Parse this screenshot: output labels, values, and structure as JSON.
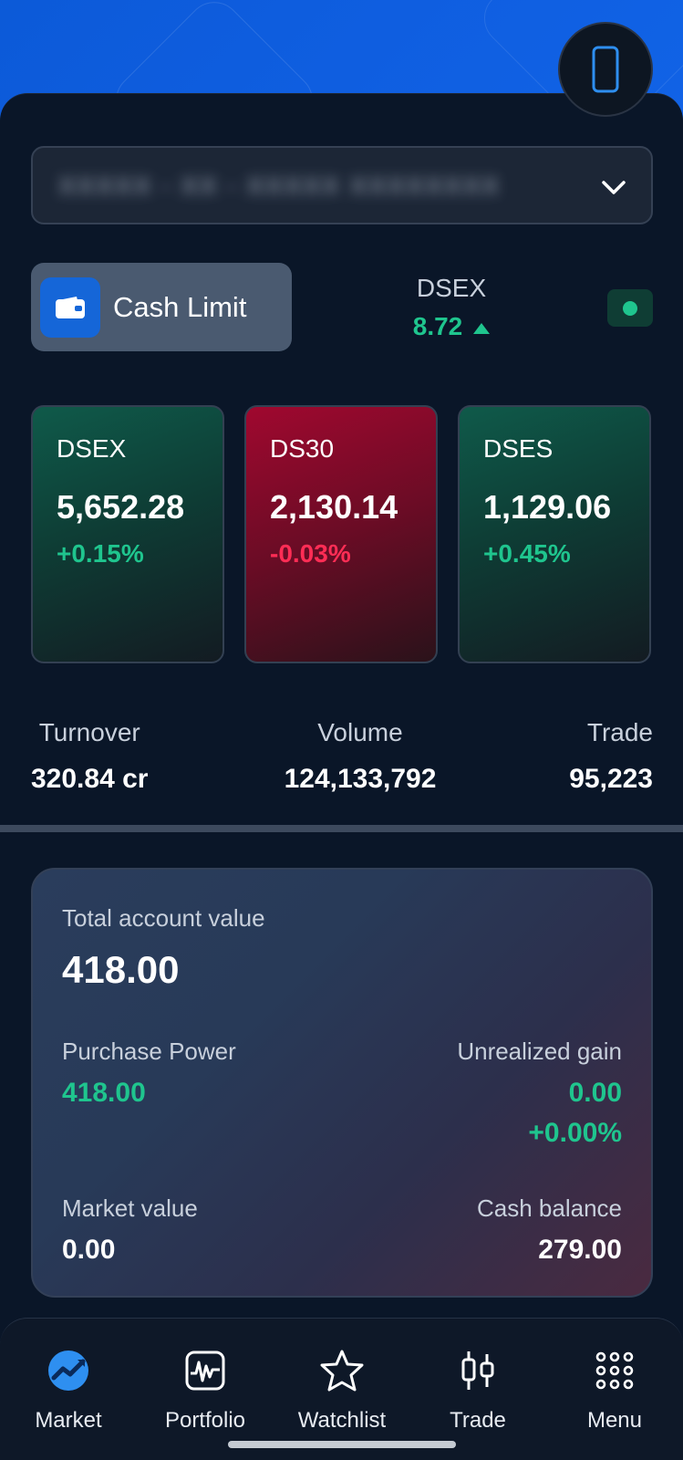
{
  "account": {
    "selected_label": "XXXXX - XX - XXXXX XXXXXXXX"
  },
  "cash_limit": {
    "label": "Cash Limit"
  },
  "dsex_summary": {
    "name": "DSEX",
    "change": "8.72"
  },
  "colors": {
    "brand": "#0c5ad8",
    "up": "#1fc58e",
    "down": "#ff2d55",
    "background": "#0a1628"
  },
  "indices": [
    {
      "name": "DSEX",
      "value": "5,652.28",
      "change": "+0.15%",
      "trend": "up"
    },
    {
      "name": "DS30",
      "value": "2,130.14",
      "change": "-0.03%",
      "trend": "down"
    },
    {
      "name": "DSES",
      "value": "1,129.06",
      "change": "+0.45%",
      "trend": "up"
    }
  ],
  "stats": {
    "turnover_label": "Turnover",
    "turnover_value": "320.84 cr",
    "volume_label": "Volume",
    "volume_value": "124,133,792",
    "trade_label": "Trade",
    "trade_value": "95,223"
  },
  "account_summary": {
    "total_label": "Total account value",
    "total_value": "418.00",
    "purchase_power_label": "Purchase Power",
    "purchase_power_value": "418.00",
    "unrealized_label": "Unrealized gain",
    "unrealized_value": "0.00",
    "unrealized_pct": "+0.00%",
    "market_value_label": "Market value",
    "market_value": "0.00",
    "cash_balance_label": "Cash balance",
    "cash_balance": "279.00"
  },
  "nav": [
    {
      "label": "Market",
      "icon": "market-icon",
      "active": true
    },
    {
      "label": "Portfolio",
      "icon": "portfolio-icon"
    },
    {
      "label": "Watchlist",
      "icon": "star-icon"
    },
    {
      "label": "Trade",
      "icon": "candlestick-icon"
    },
    {
      "label": "Menu",
      "icon": "grid-menu-icon"
    }
  ]
}
